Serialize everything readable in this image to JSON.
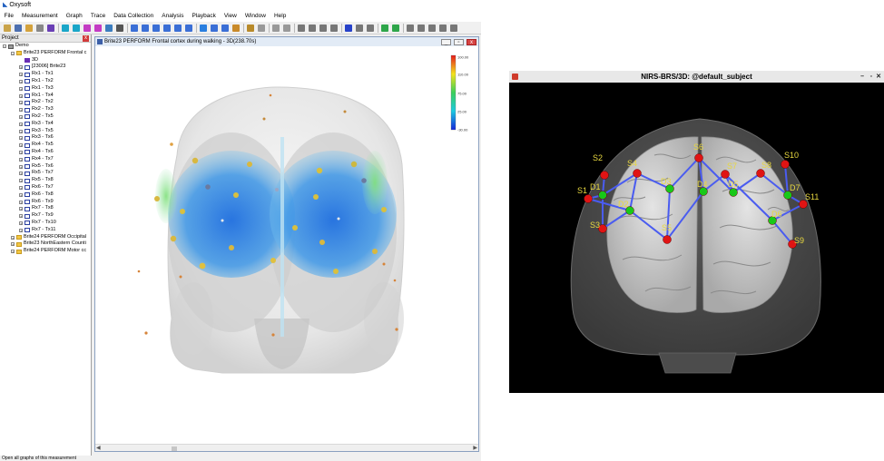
{
  "oxysoft": {
    "app_title": "Oxysoft",
    "menu": [
      "File",
      "Measurement",
      "Graph",
      "Trace",
      "Data Collection",
      "Analysis",
      "Playback",
      "View",
      "Window",
      "Help"
    ],
    "project_panel": {
      "title": "Project",
      "close_label": "x",
      "items": [
        {
          "label": "Demo",
          "level": 0,
          "expander": "−",
          "icon": "computer-icon"
        },
        {
          "label": "Brite23 PERFORM Frontal c",
          "level": 1,
          "expander": "−",
          "icon": "folder-icon"
        },
        {
          "label": "3D",
          "level": 2,
          "expander": "",
          "icon": "3d-view-icon"
        },
        {
          "label": "[23006] Brite23",
          "level": 2,
          "expander": "+",
          "icon": "channel-icon"
        },
        {
          "label": "Rx1 - Tx1",
          "level": 2,
          "expander": "+",
          "icon": "channel-icon"
        },
        {
          "label": "Rx1 - Tx2",
          "level": 2,
          "expander": "+",
          "icon": "channel-icon"
        },
        {
          "label": "Rx1 - Tx3",
          "level": 2,
          "expander": "+",
          "icon": "channel-icon"
        },
        {
          "label": "Rx1 - Tx4",
          "level": 2,
          "expander": "+",
          "icon": "channel-icon"
        },
        {
          "label": "Rx2 - Tx2",
          "level": 2,
          "expander": "+",
          "icon": "channel-icon"
        },
        {
          "label": "Rx2 - Tx3",
          "level": 2,
          "expander": "+",
          "icon": "channel-icon"
        },
        {
          "label": "Rx2 - Tx5",
          "level": 2,
          "expander": "+",
          "icon": "channel-icon"
        },
        {
          "label": "Rx3 - Tx4",
          "level": 2,
          "expander": "+",
          "icon": "channel-icon"
        },
        {
          "label": "Rx3 - Tx5",
          "level": 2,
          "expander": "+",
          "icon": "channel-icon"
        },
        {
          "label": "Rx3 - Tx6",
          "level": 2,
          "expander": "+",
          "icon": "channel-icon"
        },
        {
          "label": "Rx4 - Tx5",
          "level": 2,
          "expander": "+",
          "icon": "channel-icon"
        },
        {
          "label": "Rx4 - Tx6",
          "level": 2,
          "expander": "+",
          "icon": "channel-icon"
        },
        {
          "label": "Rx4 - Tx7",
          "level": 2,
          "expander": "+",
          "icon": "channel-icon"
        },
        {
          "label": "Rx5 - Tx6",
          "level": 2,
          "expander": "+",
          "icon": "channel-icon"
        },
        {
          "label": "Rx5 - Tx7",
          "level": 2,
          "expander": "+",
          "icon": "channel-icon"
        },
        {
          "label": "Rx5 - Tx8",
          "level": 2,
          "expander": "+",
          "icon": "channel-icon"
        },
        {
          "label": "Rx6 - Tx7",
          "level": 2,
          "expander": "+",
          "icon": "channel-icon"
        },
        {
          "label": "Rx6 - Tx8",
          "level": 2,
          "expander": "+",
          "icon": "channel-icon"
        },
        {
          "label": "Rx6 - Tx9",
          "level": 2,
          "expander": "+",
          "icon": "channel-icon"
        },
        {
          "label": "Rx7 - Tx8",
          "level": 2,
          "expander": "+",
          "icon": "channel-icon"
        },
        {
          "label": "Rx7 - Tx9",
          "level": 2,
          "expander": "+",
          "icon": "channel-icon"
        },
        {
          "label": "Rx7 - Tx10",
          "level": 2,
          "expander": "+",
          "icon": "channel-icon"
        },
        {
          "label": "Rx7 - Tx11",
          "level": 2,
          "expander": "+",
          "icon": "channel-icon"
        },
        {
          "label": "Brite24 PERFORM Occipital",
          "level": 1,
          "expander": "+",
          "icon": "folder-icon"
        },
        {
          "label": "Brite23 NorthEastern Counti",
          "level": 1,
          "expander": "+",
          "icon": "folder-icon"
        },
        {
          "label": "Brite24 PERFORM Motor cc",
          "level": 1,
          "expander": "+",
          "icon": "folder-icon"
        }
      ]
    },
    "view_window": {
      "title": "Brite23 PERFORM Frontal cortex during walking - 3D(238.70s)",
      "colorbar_ticks": [
        "100.00",
        "110.00",
        "75.00",
        "25.00",
        "-30.00"
      ]
    },
    "status_text": "Open all graphs of this measurement"
  },
  "nirs": {
    "title": "NIRS-BRS/3D: @default_subject",
    "controls": [
      "–",
      "▫",
      "✕"
    ],
    "sources": [
      "S1",
      "S2",
      "S3",
      "S4",
      "S5",
      "S6",
      "S7",
      "S8",
      "S9",
      "S10",
      "S11"
    ],
    "detectors": [
      "D1",
      "D2",
      "D3",
      "D4",
      "D5",
      "D6",
      "D7"
    ],
    "colors": {
      "source": "#e01414",
      "detector": "#18c818",
      "channel": "#4a5cf0",
      "label": "#e8d840"
    }
  }
}
